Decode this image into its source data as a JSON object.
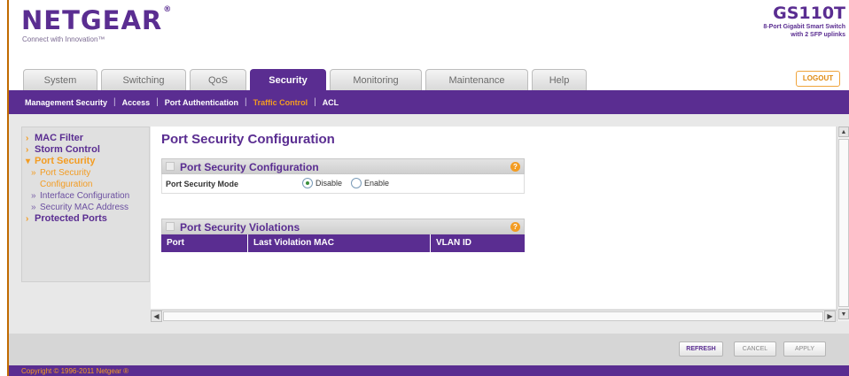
{
  "brand": {
    "logo": "NETGEAR",
    "logo_mark": "®",
    "tagline": "Connect with Innovation™"
  },
  "product": {
    "model": "GS110T",
    "desc_line1": "8-Port Gigabit Smart Switch",
    "desc_line2": "with 2 SFP uplinks"
  },
  "tabs": [
    {
      "label": "System"
    },
    {
      "label": "Switching"
    },
    {
      "label": "QoS"
    },
    {
      "label": "Security",
      "active": true
    },
    {
      "label": "Monitoring"
    },
    {
      "label": "Maintenance"
    },
    {
      "label": "Help"
    }
  ],
  "logout_label": "LOGOUT",
  "subnav": [
    {
      "label": "Management Security"
    },
    {
      "label": "Access"
    },
    {
      "label": "Port Authentication"
    },
    {
      "label": "Traffic Control",
      "active": true
    },
    {
      "label": "ACL"
    }
  ],
  "leftmenu": {
    "mac_filter": "MAC Filter",
    "storm_control": "Storm Control",
    "port_security": "Port Security",
    "sub_port_security_config": "Port Security Configuration",
    "sub_interface_config": "Interface Configuration",
    "sub_security_mac": "Security MAC Address",
    "protected_ports": "Protected Ports"
  },
  "main": {
    "page_title": "Port Security Configuration",
    "config_section_title": "Port Security Configuration",
    "mode_label": "Port Security Mode",
    "mode_options": {
      "disable": "Disable",
      "enable": "Enable"
    },
    "mode_selected": "Disable",
    "violations_section_title": "Port Security Violations",
    "violations_columns": {
      "port": "Port",
      "mac": "Last Violation MAC",
      "vlan": "VLAN ID"
    },
    "help_glyph": "?"
  },
  "buttons": {
    "refresh": "REFRESH",
    "cancel": "CANCEL",
    "apply": "APPLY"
  },
  "copyright": "Copyright © 1996-2011 Netgear ®",
  "colors": {
    "brand_purple": "#5a2d91",
    "accent_orange": "#f39c22"
  }
}
